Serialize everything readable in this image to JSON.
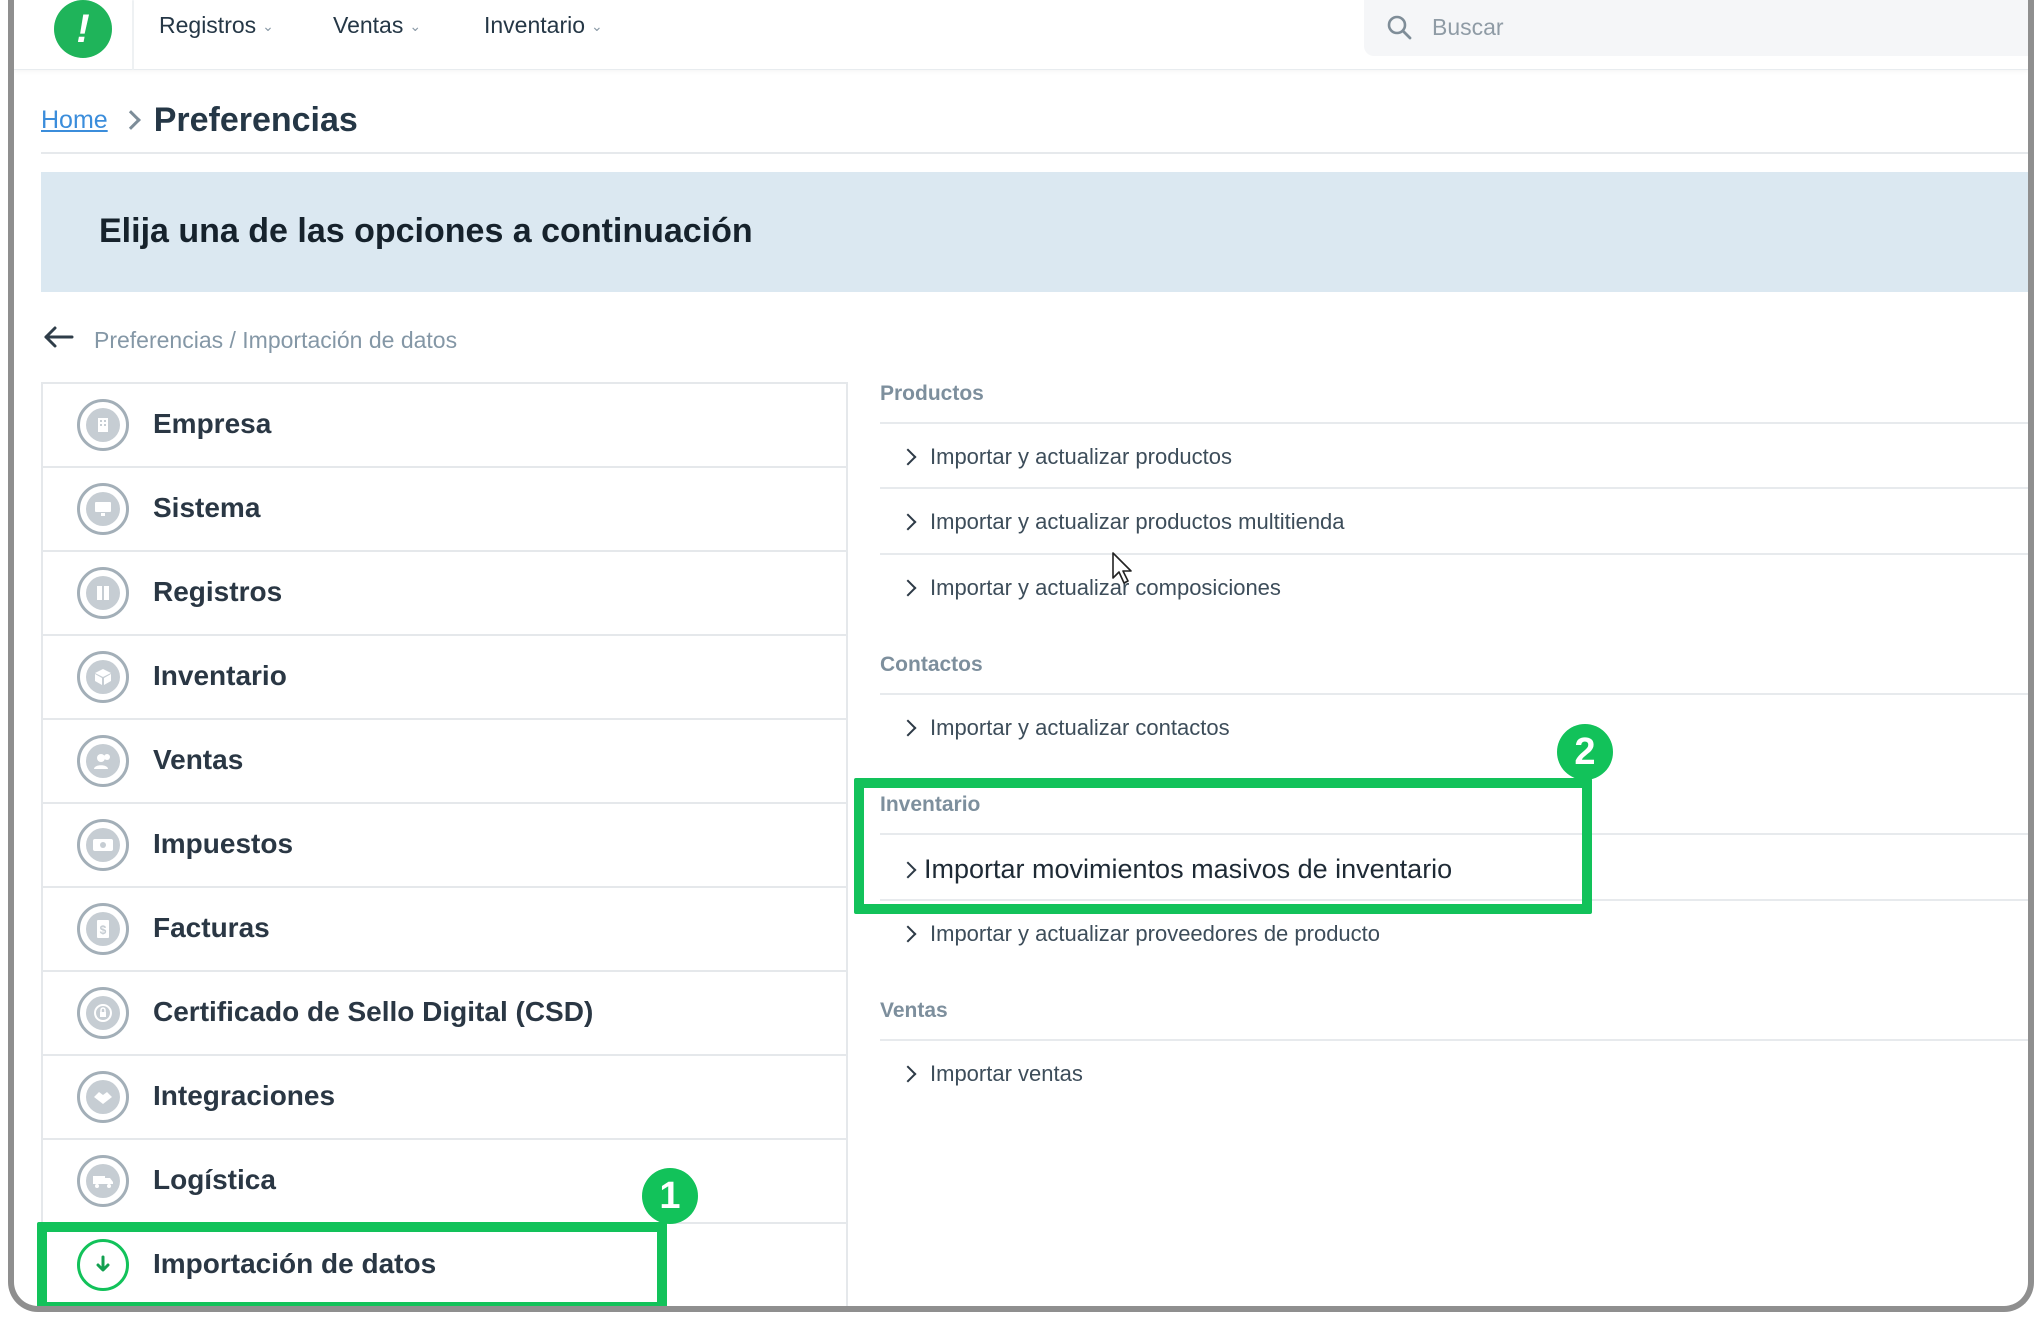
{
  "topbar": {
    "logo_text": "!",
    "nav": [
      "Registros",
      "Ventas",
      "Inventario"
    ],
    "search_placeholder": "Buscar"
  },
  "breadcrumb": {
    "home": "Home",
    "current": "Preferencias"
  },
  "banner": {
    "title": "Elija una de las opciones a continuación"
  },
  "path": "Preferencias / Importación de datos",
  "menu": [
    {
      "label": "Empresa",
      "icon": "building-icon"
    },
    {
      "label": "Sistema",
      "icon": "monitor-icon"
    },
    {
      "label": "Registros",
      "icon": "book-icon"
    },
    {
      "label": "Inventario",
      "icon": "box-icon"
    },
    {
      "label": "Ventas",
      "icon": "users-icon"
    },
    {
      "label": "Impuestos",
      "icon": "money-icon"
    },
    {
      "label": "Facturas",
      "icon": "invoice-icon"
    },
    {
      "label": "Certificado de Sello Digital (CSD)",
      "icon": "lock-icon"
    },
    {
      "label": "Integraciones",
      "icon": "handshake-icon"
    },
    {
      "label": "Logística",
      "icon": "truck-icon"
    },
    {
      "label": "Importación de datos",
      "icon": "import-icon"
    }
  ],
  "sections": {
    "productos": {
      "title": "Productos",
      "options": [
        "Importar y actualizar productos",
        "Importar y actualizar productos multitienda",
        "Importar y actualizar composiciones"
      ]
    },
    "contactos": {
      "title": "Contactos",
      "options": [
        "Importar y actualizar contactos"
      ]
    },
    "inventario": {
      "title": "Inventario",
      "options": [
        "Importar movimientos masivos de inventario",
        "Importar y actualizar proveedores de producto"
      ]
    },
    "ventas": {
      "title": "Ventas",
      "options": [
        "Importar ventas"
      ]
    }
  },
  "badges": [
    "1",
    "2"
  ],
  "colors": {
    "highlight": "#12c25a",
    "brand": "#1fb45a",
    "banner_bg": "#dbe8f1",
    "link": "#3b8ddb"
  }
}
